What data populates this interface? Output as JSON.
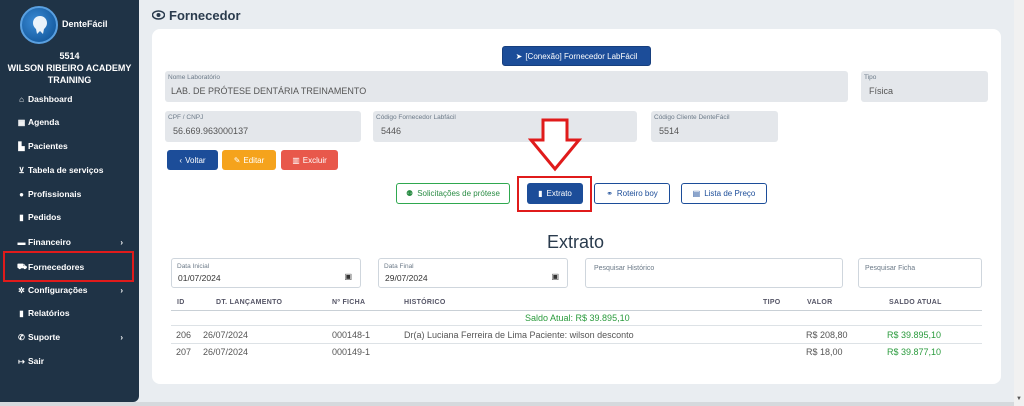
{
  "sidebar": {
    "brand": "DenteFácil",
    "clinic_id": "5514",
    "clinic_name": "WILSON RIBEIRO ACADEMY TRAINING",
    "items": [
      {
        "label": "Dashboard",
        "icon": "home-icon"
      },
      {
        "label": "Agenda",
        "icon": "calendar-icon"
      },
      {
        "label": "Pacientes",
        "icon": "patients-icon"
      },
      {
        "label": "Tabela de serviços",
        "icon": "cart-icon"
      },
      {
        "label": "Profissionais",
        "icon": "user-icon"
      },
      {
        "label": "Pedidos",
        "icon": "file-icon"
      },
      {
        "label": "Financeiro",
        "icon": "money-icon"
      },
      {
        "label": "Fornecedores",
        "icon": "truck-icon"
      },
      {
        "label": "Configurações",
        "icon": "gear-icon"
      },
      {
        "label": "Relatórios",
        "icon": "file-icon"
      },
      {
        "label": "Suporte",
        "icon": "phone-icon"
      },
      {
        "label": "Sair",
        "icon": "logout-icon"
      }
    ]
  },
  "header": {
    "title": "Fornecedor"
  },
  "connection_button": "[Conexão] Fornecedor LabFácil",
  "fields": {
    "nome_label": "Nome Laboratório",
    "nome_value": "LAB. DE PRÓTESE DENTÁRIA TREINAMENTO",
    "tipo_label": "Tipo",
    "tipo_value": "Física",
    "cpf_label": "CPF / CNPJ",
    "cpf_value": "56.669.963000137",
    "codforn_label": "Código Fornecedor Labfácil",
    "codforn_value": "5446",
    "codcli_label": "Código Cliente DenteFácil",
    "codcli_value": "5514"
  },
  "actions": {
    "voltar": "Voltar",
    "editar": "Editar",
    "excluir": "Excluir"
  },
  "tabs": {
    "solicitacoes": "Solicitações de prótese",
    "extrato": "Extrato",
    "roteiro": "Roteiro boy",
    "lista": "Lista de Preço"
  },
  "extrato": {
    "title": "Extrato",
    "data_inicial_label": "Data Inicial",
    "data_inicial_value": "01/07/2024",
    "data_final_label": "Data Final",
    "data_final_value": "29/07/2024",
    "pesquisar_historico": "Pesquisar Histórico",
    "pesquisar_ficha": "Pesquisar Ficha",
    "columns": [
      "ID",
      "DT. LANÇAMENTO",
      "Nº FICHA",
      "HISTÓRICO",
      "TIPO",
      "VALOR",
      "SALDO ATUAL"
    ],
    "saldo_atual": "Saldo Atual: R$ 39.895,10",
    "rows": [
      {
        "id": "206",
        "data": "26/07/2024",
        "ficha": "000148-1",
        "historico": "Dr(a) Luciana Ferreira de Lima Paciente: wilson desconto",
        "tipo": "",
        "valor": "R$ 208,80",
        "saldo": "R$ 39.895,10"
      },
      {
        "id": "207",
        "data": "26/07/2024",
        "ficha": "000149-1",
        "historico": "",
        "tipo": "",
        "valor": "R$ 18,00",
        "saldo": "R$ 39.877,10"
      }
    ]
  },
  "colors": {
    "primary": "#1c4d99",
    "sidebar": "#1f3346",
    "highlight": "#e01b1b",
    "success": "#2a9b3d"
  }
}
